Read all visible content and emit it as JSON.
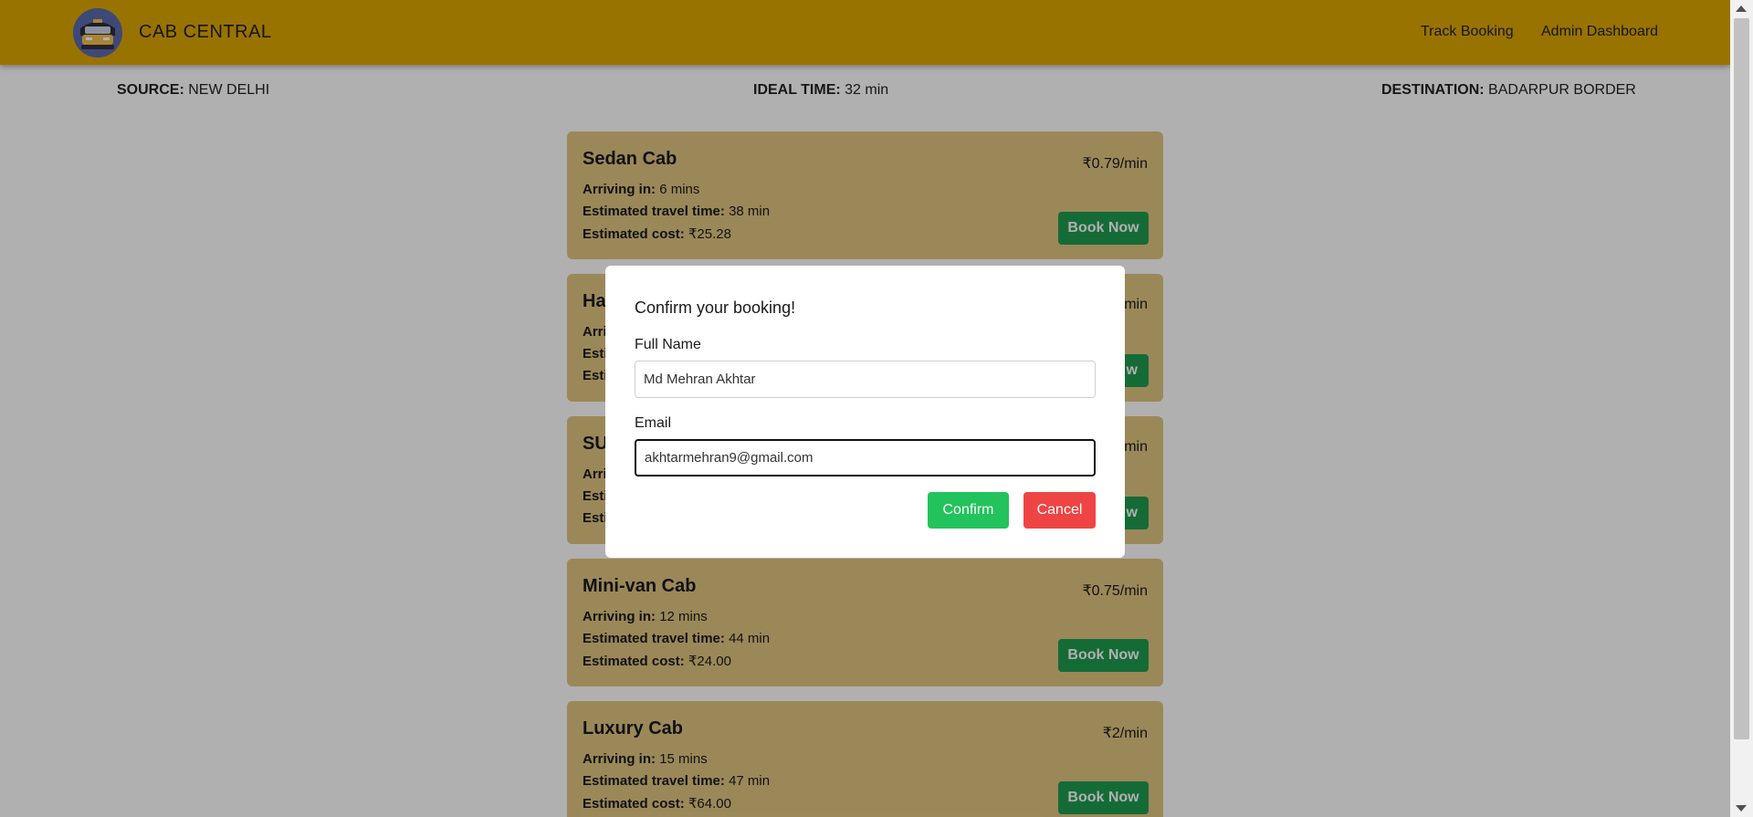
{
  "app": {
    "brand": "CAB CENTRAL"
  },
  "nav": {
    "track_booking": "Track Booking",
    "admin_dashboard": "Admin Dashboard"
  },
  "route": {
    "source_label": "SOURCE:",
    "source_value": "NEW DELHI",
    "ideal_label": "IDEAL TIME:",
    "ideal_value": "32 min",
    "destination_label": "DESTINATION:",
    "destination_value": "BADARPUR BORDER"
  },
  "labels": {
    "arriving": "Arriving in:",
    "travel": "Estimated travel time:",
    "cost": "Estimated cost:",
    "book_now": "Book Now"
  },
  "cabs": [
    {
      "name": "Sedan Cab",
      "rate": "₹0.79/min",
      "arriving": "6 mins",
      "travel": "38 min",
      "cost": "₹25.28"
    },
    {
      "name": "Ha",
      "rate": "min",
      "arriving": "",
      "travel": "",
      "cost": ""
    },
    {
      "name": "SU",
      "rate": "min",
      "arriving": "",
      "travel": "",
      "cost": ""
    },
    {
      "name": "Mini-van Cab",
      "rate": "₹0.75/min",
      "arriving": "12 mins",
      "travel": "44 min",
      "cost": "₹24.00"
    },
    {
      "name": "Luxury Cab",
      "rate": "₹2/min",
      "arriving": "15 mins",
      "travel": "47 min",
      "cost": "₹64.00"
    }
  ],
  "partial_labels": {
    "arriving": "Arri",
    "travel": "Esti",
    "cost": "Esti",
    "book": "w"
  },
  "modal": {
    "title": "Confirm your booking!",
    "name_label": "Full Name",
    "name_value": "Md Mehran Akhtar",
    "email_label": "Email",
    "email_value": "akhtarmehran9@gmail.com",
    "confirm": "Confirm",
    "cancel": "Cancel"
  },
  "colors": {
    "navbar": "#dea700",
    "card": "#e1c681",
    "book_button": "#1f9b4f",
    "confirm_button": "#22c35c",
    "cancel_button": "#ef4444"
  }
}
